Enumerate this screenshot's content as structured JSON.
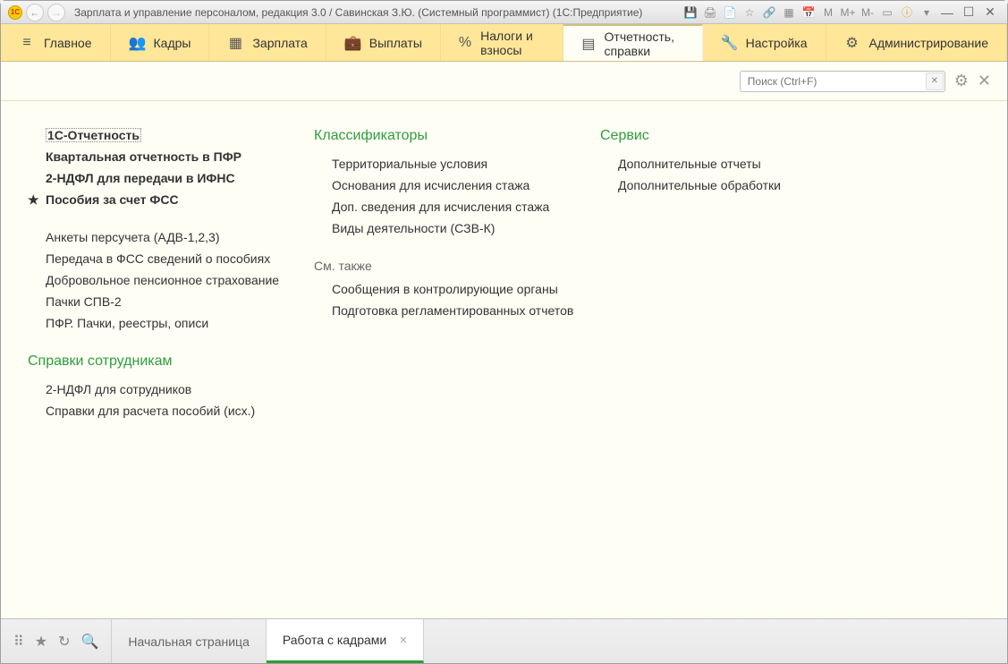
{
  "title": "Зарплата и управление персоналом, редакция 3.0 / Савинская З.Ю. (Системный программист)  (1С:Предприятие)",
  "logo": "1C",
  "title_right_labels": {
    "m": "M",
    "mplus": "M+",
    "mminus": "M-"
  },
  "menu": [
    {
      "icon": "≡",
      "label": "Главное"
    },
    {
      "icon": "👥",
      "label": "Кадры"
    },
    {
      "icon": "▦",
      "label": "Зарплата"
    },
    {
      "icon": "💼",
      "label": "Выплаты"
    },
    {
      "icon": "%",
      "label": "Налоги и взносы"
    },
    {
      "icon": "▤",
      "label": "Отчетность, справки"
    },
    {
      "icon": "🔧",
      "label": "Настройка"
    },
    {
      "icon": "⚙",
      "label": "Администрирование"
    }
  ],
  "search_placeholder": "Поиск (Ctrl+F)",
  "col1": {
    "group1": [
      {
        "label": "1С-Отчетность",
        "bold": true,
        "selected": true
      },
      {
        "label": "Квартальная отчетность в ПФР",
        "bold": true
      },
      {
        "label": "2-НДФЛ для передачи в ИФНС",
        "bold": true
      },
      {
        "label": "Пособия за счет ФСС",
        "bold": true,
        "star": true
      }
    ],
    "group2": [
      {
        "label": "Анкеты персучета (АДВ-1,2,3)"
      },
      {
        "label": "Передача в ФСС сведений о пособиях"
      },
      {
        "label": "Добровольное пенсионное страхование"
      },
      {
        "label": "Пачки СПВ-2"
      },
      {
        "label": "ПФР. Пачки, реестры, описи"
      }
    ],
    "section2_header": "Справки сотрудникам",
    "group3": [
      {
        "label": "2-НДФЛ для сотрудников"
      },
      {
        "label": "Справки для расчета пособий (исх.)"
      }
    ]
  },
  "col2": {
    "header": "Классификаторы",
    "group1": [
      {
        "label": "Территориальные условия"
      },
      {
        "label": "Основания для исчисления стажа"
      },
      {
        "label": "Доп. сведения для исчисления стажа"
      },
      {
        "label": "Виды деятельности (СЗВ-К)"
      }
    ],
    "subheader": "См. также",
    "group2": [
      {
        "label": "Сообщения в контролирующие органы"
      },
      {
        "label": "Подготовка регламентированных отчетов"
      }
    ]
  },
  "col3": {
    "header": "Сервис",
    "group1": [
      {
        "label": "Дополнительные отчеты"
      },
      {
        "label": "Дополнительные обработки"
      }
    ]
  },
  "bottom_tabs": [
    {
      "label": "Начальная страница",
      "active": false,
      "closable": false
    },
    {
      "label": "Работа с кадрами",
      "active": true,
      "closable": true
    }
  ]
}
